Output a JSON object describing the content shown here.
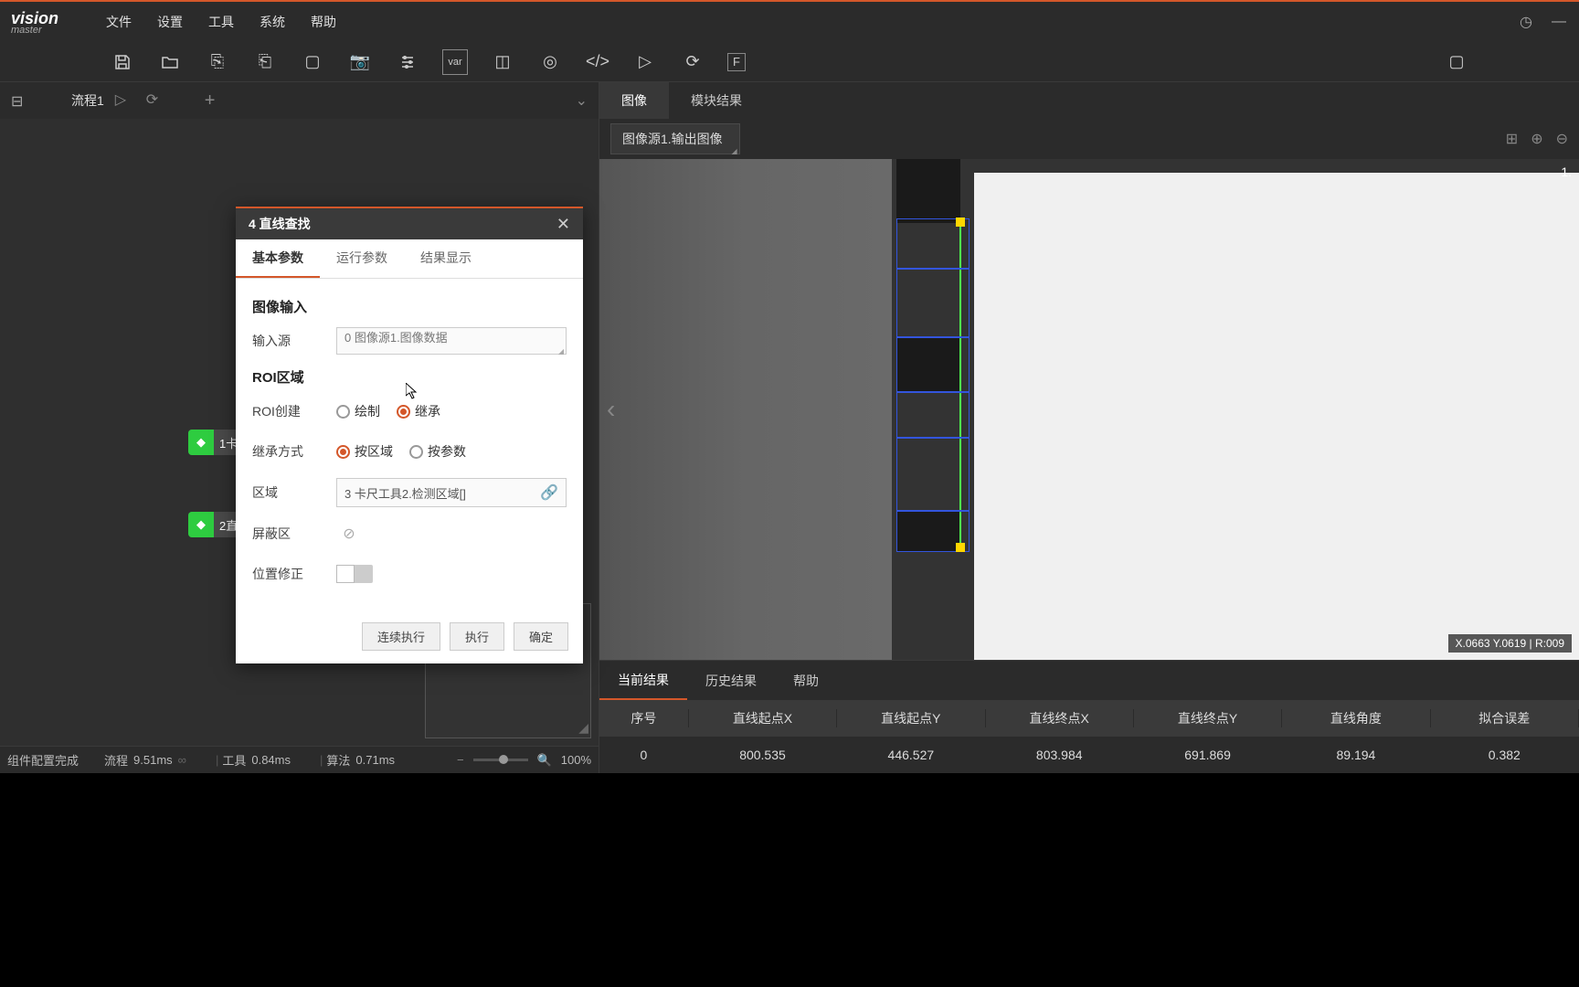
{
  "app": {
    "logo_top": "vision",
    "logo_bottom": "master"
  },
  "menu": {
    "file": "文件",
    "settings": "设置",
    "tools": "工具",
    "system": "系统",
    "help": "帮助"
  },
  "proc": {
    "title": "流程1"
  },
  "nodes": {
    "n1": "1卡",
    "n2": "2直"
  },
  "image_tabs": {
    "image": "图像",
    "module_result": "模块结果"
  },
  "image_source": "图像源1.输出图像",
  "coord_overlay": "X.0663 Y.0619 | R:009",
  "scale_ind": "1.",
  "result_tabs": {
    "current": "当前结果",
    "history": "历史结果",
    "help": "帮助"
  },
  "table": {
    "headers": {
      "idx": "序号",
      "sx": "直线起点X",
      "sy": "直线起点Y",
      "ex": "直线终点X",
      "ey": "直线终点Y",
      "angle": "直线角度",
      "err": "拟合误差"
    },
    "row": {
      "idx": "0",
      "sx": "800.535",
      "sy": "446.527",
      "ex": "803.984",
      "ey": "691.869",
      "angle": "89.194",
      "err": "0.382"
    }
  },
  "dialog": {
    "title": "4 直线查找",
    "tabs": {
      "basic": "基本参数",
      "run": "运行参数",
      "result": "结果显示"
    },
    "section_input": "图像输入",
    "input_source_label": "输入源",
    "input_source_value": "0 图像源1.图像数据",
    "section_roi": "ROI区域",
    "roi_create_label": "ROI创建",
    "roi_draw": "绘制",
    "roi_inherit": "继承",
    "inherit_mode_label": "继承方式",
    "by_region": "按区域",
    "by_param": "按参数",
    "region_label": "区域",
    "region_value": "3 卡尺工具2.检测区域[]",
    "mask_label": "屏蔽区",
    "pos_correct_label": "位置修正",
    "btn_continuous": "连续执行",
    "btn_execute": "执行",
    "btn_confirm": "确定"
  },
  "status": {
    "config_done": "组件配置完成",
    "flow_label": "流程",
    "flow_time": "9.51ms",
    "tool_label": "工具",
    "tool_time": "0.84ms",
    "algo_label": "算法",
    "algo_time": "0.71ms",
    "zoom": "100%"
  }
}
